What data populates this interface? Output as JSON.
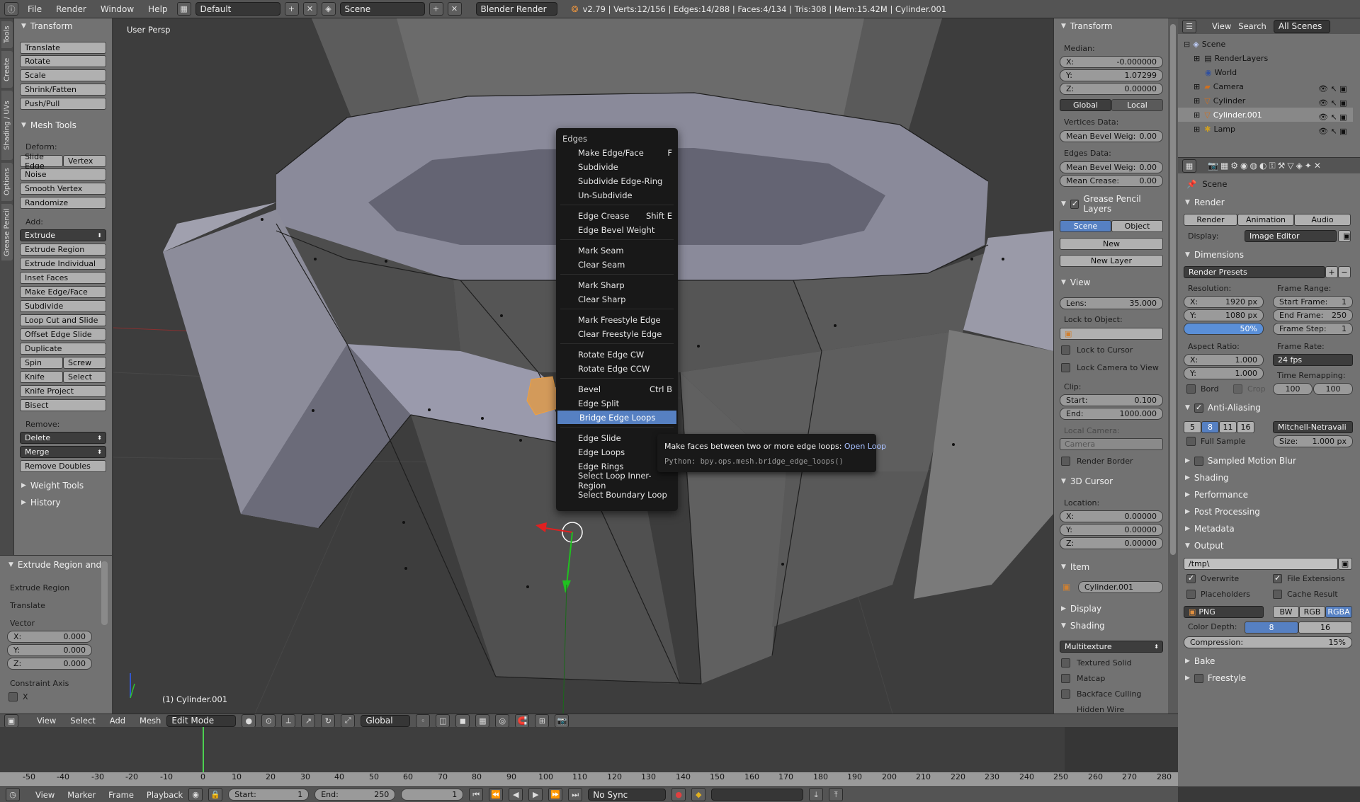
{
  "topbar": {
    "info_icon": "info-icon",
    "menus": [
      "File",
      "Render",
      "Window",
      "Help"
    ],
    "layout": "Default",
    "scene": "Scene",
    "engine": "Blender Render",
    "stats": "v2.79 | Verts:12/156 | Edges:14/288 | Faces:4/134 | Tris:308 | Mem:15.42M | Cylinder.001"
  },
  "left_tabs": [
    "Tools",
    "Create",
    "Shading / UVs",
    "Options",
    "Grease Pencil"
  ],
  "toolshelf": {
    "transform_header": "Transform",
    "transform_buttons": [
      "Translate",
      "Rotate",
      "Scale",
      "Shrink/Fatten",
      "Push/Pull"
    ],
    "mesh_tools_header": "Mesh Tools",
    "deform_label": "Deform:",
    "slide_edge": "Slide Edge",
    "vertex": "Vertex",
    "deform_buttons": [
      "Noise",
      "Smooth Vertex",
      "Randomize"
    ],
    "add_label": "Add:",
    "extrude": "Extrude",
    "add_buttons": [
      "Extrude Region",
      "Extrude Individual",
      "Inset Faces",
      "Make Edge/Face",
      "Subdivide",
      "Loop Cut and Slide",
      "Offset Edge Slide",
      "Duplicate"
    ],
    "spin": "Spin",
    "screw": "Screw",
    "knife": "Knife",
    "select": "Select",
    "knife_project": "Knife Project",
    "bisect": "Bisect",
    "remove_label": "Remove:",
    "delete": "Delete",
    "merge": "Merge",
    "remove_doubles": "Remove Doubles",
    "weight_tools": "Weight Tools",
    "history": "History"
  },
  "operator_panel": {
    "header": "Extrude Region and",
    "op1": "Extrude Region",
    "op2": "Translate",
    "vector_label": "Vector",
    "x": "X:",
    "x_val": "0.000",
    "y": "Y:",
    "y_val": "0.000",
    "z": "Z:",
    "z_val": "0.000",
    "constraint_label": "Constraint Axis",
    "constraint_x": "X"
  },
  "viewport": {
    "view_label": "User Persp",
    "object_label": "(1) Cylinder.001"
  },
  "edges_menu": {
    "title": "Edges",
    "items": [
      {
        "label": "Make Edge/Face",
        "shortcut": "F"
      },
      {
        "label": "Subdivide",
        "shortcut": ""
      },
      {
        "label": "Subdivide Edge-Ring",
        "shortcut": ""
      },
      {
        "label": "Un-Subdivide",
        "shortcut": ""
      },
      {
        "label": "Edge Crease",
        "shortcut": "Shift E"
      },
      {
        "label": "Edge Bevel Weight",
        "shortcut": ""
      },
      {
        "label": "Mark Seam",
        "shortcut": ""
      },
      {
        "label": "Clear Seam",
        "shortcut": ""
      },
      {
        "label": "Mark Sharp",
        "shortcut": ""
      },
      {
        "label": "Clear Sharp",
        "shortcut": ""
      },
      {
        "label": "Mark Freestyle Edge",
        "shortcut": ""
      },
      {
        "label": "Clear Freestyle Edge",
        "shortcut": ""
      },
      {
        "label": "Rotate Edge CW",
        "shortcut": ""
      },
      {
        "label": "Rotate Edge CCW",
        "shortcut": ""
      },
      {
        "label": "Bevel",
        "shortcut": "Ctrl B"
      },
      {
        "label": "Edge Split",
        "shortcut": ""
      },
      {
        "label": "Bridge Edge Loops",
        "shortcut": ""
      },
      {
        "label": "Edge Slide",
        "shortcut": ""
      },
      {
        "label": "Edge Loops",
        "shortcut": ""
      },
      {
        "label": "Edge Rings",
        "shortcut": ""
      },
      {
        "label": "Select Loop Inner-Region",
        "shortcut": ""
      },
      {
        "label": "Select Boundary Loop",
        "shortcut": ""
      }
    ]
  },
  "tooltip": {
    "text": "Make faces between two or more edge loops:",
    "hint": "Open Loop",
    "python": "Python: bpy.ops.mesh.bridge_edge_loops()"
  },
  "properties_n": {
    "transform": "Transform",
    "median": "Median:",
    "mx": "X:",
    "mx_val": "-0.000000",
    "my": "Y:",
    "my_val": "1.07299",
    "mz": "Z:",
    "mz_val": "0.00000",
    "global": "Global",
    "local": "Local",
    "vertices_data": "Vertices Data:",
    "v_bevel": "Mean Bevel Weig:",
    "v_bevel_val": "0.00",
    "edges_data": "Edges Data:",
    "e_bevel": "Mean Bevel Weig:",
    "e_bevel_val": "0.00",
    "crease": "Mean Crease:",
    "crease_val": "0.00",
    "gp_layers": "Grease Pencil Layers",
    "scene": "Scene",
    "object": "Object",
    "new": "New",
    "new_layer": "New Layer",
    "view": "View",
    "lens": "Lens:",
    "lens_val": "35.000",
    "lock_to_object": "Lock to Object:",
    "lock_to_cursor": "Lock to Cursor",
    "lock_camera": "Lock Camera to View",
    "clip": "Clip:",
    "clip_start": "Start:",
    "clip_start_val": "0.100",
    "clip_end": "End:",
    "clip_end_val": "1000.000",
    "local_camera": "Local Camera:",
    "camera": "Camera",
    "render_border": "Render Border",
    "cursor": "3D Cursor",
    "location": "Location:",
    "cx": "X:",
    "cx_val": "0.00000",
    "cy": "Y:",
    "cy_val": "0.00000",
    "cz": "Z:",
    "cz_val": "0.00000",
    "item": "Item",
    "item_name": "Cylinder.001",
    "display": "Display",
    "shading": "Shading",
    "multitexture": "Multitexture",
    "textured_solid": "Textured Solid",
    "matcap": "Matcap",
    "backface": "Backface Culling",
    "hidden_wire": "Hidden Wire"
  },
  "outliner": {
    "view": "View",
    "search": "Search",
    "all_scenes": "All Scenes",
    "rows": [
      "Scene",
      "RenderLayers",
      "World",
      "Camera",
      "Cylinder",
      "Cylinder.001",
      "Lamp"
    ]
  },
  "render_props": {
    "scene": "Scene",
    "render": "Render",
    "render_btn": "Render",
    "animation_btn": "Animation",
    "audio_btn": "Audio",
    "display": "Display:",
    "display_val": "Image Editor",
    "dimensions": "Dimensions",
    "render_presets": "Render Presets",
    "resolution": "Resolution:",
    "res_x": "X:",
    "res_x_val": "1920 px",
    "res_y": "Y:",
    "res_y_val": "1080 px",
    "res_pct": "50%",
    "frame_range": "Frame Range:",
    "start_frame": "Start Frame:",
    "start_frame_val": "1",
    "end_frame": "End Frame:",
    "end_frame_val": "250",
    "frame_step": "Frame Step:",
    "frame_step_val": "1",
    "aspect": "Aspect Ratio:",
    "ax": "X:",
    "ax_val": "1.000",
    "ay": "Y:",
    "ay_val": "1.000",
    "frame_rate": "Frame Rate:",
    "fps": "24 fps",
    "time_remap": "Time Remapping:",
    "remap_old": "100",
    "remap_new": "100",
    "bord": "Bord",
    "crop": "Crop",
    "anti_aliasing": "Anti-Aliasing",
    "aa": [
      "5",
      "8",
      "11",
      "16"
    ],
    "filter": "Mitchell-Netravali",
    "full_sample": "Full Sample",
    "size": "Size:",
    "size_val": "1.000 px",
    "sampled_motion_blur": "Sampled Motion Blur",
    "shading": "Shading",
    "performance": "Performance",
    "post_processing": "Post Processing",
    "metadata": "Metadata",
    "output": "Output",
    "output_path": "/tmp\\",
    "overwrite": "Overwrite",
    "file_ext": "File Extensions",
    "placeholders": "Placeholders",
    "cache_result": "Cache Result",
    "format": "PNG",
    "bw": "BW",
    "rgb": "RGB",
    "rgba": "RGBA",
    "color_depth": "Color Depth:",
    "depth8": "8",
    "depth16": "16",
    "compression": "Compression:",
    "compression_val": "15%",
    "bake": "Bake",
    "freestyle": "Freestyle"
  },
  "viewport_header": {
    "view": "View",
    "select": "Select",
    "add": "Add",
    "mesh": "Mesh",
    "mode": "Edit Mode",
    "orientation": "Global"
  },
  "timeline": {
    "ticks": [
      "-50",
      "-40",
      "-30",
      "-20",
      "-10",
      "0",
      "10",
      "20",
      "30",
      "40",
      "50",
      "60",
      "70",
      "80",
      "90",
      "100",
      "110",
      "120",
      "130",
      "140",
      "150",
      "160",
      "170",
      "180",
      "190",
      "200",
      "210",
      "220",
      "230",
      "240",
      "250",
      "260",
      "270",
      "280"
    ],
    "view": "View",
    "marker": "Marker",
    "frame": "Frame",
    "playback": "Playback",
    "start": "Start:",
    "start_val": "1",
    "end": "End:",
    "end_val": "250",
    "current": "1",
    "sync": "No Sync"
  },
  "colors": {
    "accent": "#5680c2",
    "panel": "#727272",
    "selection": "#e0a060"
  }
}
